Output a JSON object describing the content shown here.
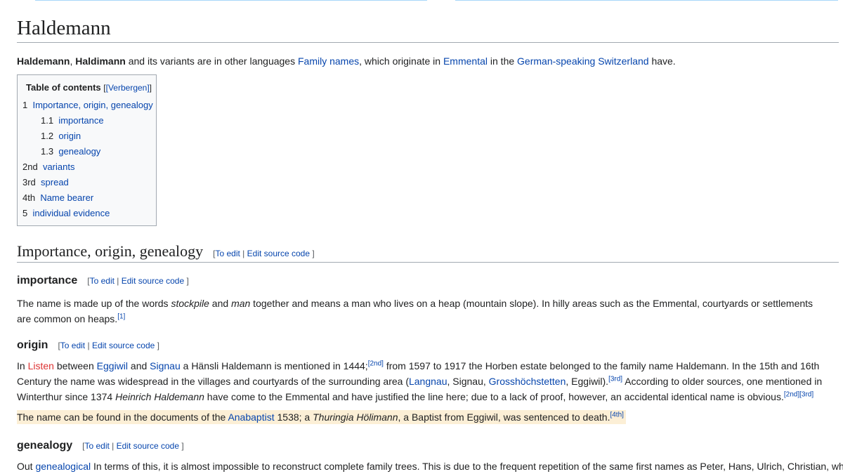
{
  "title": "Haldemann",
  "lead": {
    "b1": "Haldemann",
    "sep": ", ",
    "b2": "Haldimann",
    "t1": " and its variants are in other languages ",
    "l1": "Family names",
    "t2": ", which originate in ",
    "l2": "Emmental",
    "t3": " in the ",
    "l3": "German-speaking Switzerland",
    "t4": " have."
  },
  "toc": {
    "title": "Table of contents",
    "toggle": "[Verbergen]",
    "items": [
      {
        "num": "1",
        "label": "Importance, origin, genealogy"
      },
      {
        "num": "1.1",
        "label": "importance"
      },
      {
        "num": "1.2",
        "label": "origin"
      },
      {
        "num": "1.3",
        "label": "genealogy"
      },
      {
        "num": "2nd",
        "label": "variants"
      },
      {
        "num": "3rd",
        "label": "spread"
      },
      {
        "num": "4th",
        "label": "Name bearer"
      },
      {
        "num": "5",
        "label": "individual evidence"
      }
    ]
  },
  "edit": {
    "open": "[",
    "to_edit": "To edit",
    "sep": " | ",
    "edit_source": "Edit source code",
    "close": " ]"
  },
  "sections": {
    "main": {
      "heading": "Importance, origin, genealogy"
    },
    "importance": {
      "heading": "importance",
      "p1": "The name is made up of the words ",
      "i1": "stockpile",
      "p2": " and ",
      "i2": "man",
      "p3": " together and means a man who lives on a heap (mountain slope). In hilly areas such as the Emmental, courtyards or settlements are common on heaps.",
      "ref1": "[1]"
    },
    "origin": {
      "heading": "origin",
      "l1_t1": "In ",
      "l1_red": "Listen",
      "l1_t2": " between ",
      "l1_link1": "Eggiwil",
      "l1_t3": " and ",
      "l1_link2": "Signau",
      "l1_t4": " a Hänsli Haldemann is mentioned in 1444;",
      "l1_ref": "[2nd]",
      "l1_t5": " from 1597 to 1917 the Horben estate belonged to the family name Haldemann. In the 15th and 16th",
      "l2_t1": "Century the name was widespread in the villages and courtyards of the surrounding area (",
      "l2_link1": "Langnau",
      "l2_t2": ", Signau, ",
      "l2_link2": "Grosshöchstetten",
      "l2_t3": ", Eggiwil).",
      "l2_ref": "[3rd]",
      "l2_t4": " According to older sources, one mentioned in",
      "l3_t1": "Winterthur since 1374 ",
      "l3_i1": "Heinrich Haldemann",
      "l3_t2": " have come to the Emmental and have justified the line here; due to a lack of proof, however, an accidental identical name is obvious.",
      "l3_ref": "[2nd][3rd]",
      "l4_t1": "The name can be found in the documents of the ",
      "l4_link": "Anabaptist",
      "l4_t2": " 1538; a ",
      "l4_i1": "Thuringia Hölimann",
      "l4_t3": ", a Baptist from Eggiwil, was sentenced to death.",
      "l4_ref": "[4th]"
    },
    "genealogy": {
      "heading": "genealogy",
      "t1": "Out ",
      "link": "genealogical",
      "t2": " In terms of this, it is almost impossible to reconstruct complete family trees. This is due to the frequent repetition of the same first names as Peter, Hans, Ulrich, Christian, which"
    }
  }
}
